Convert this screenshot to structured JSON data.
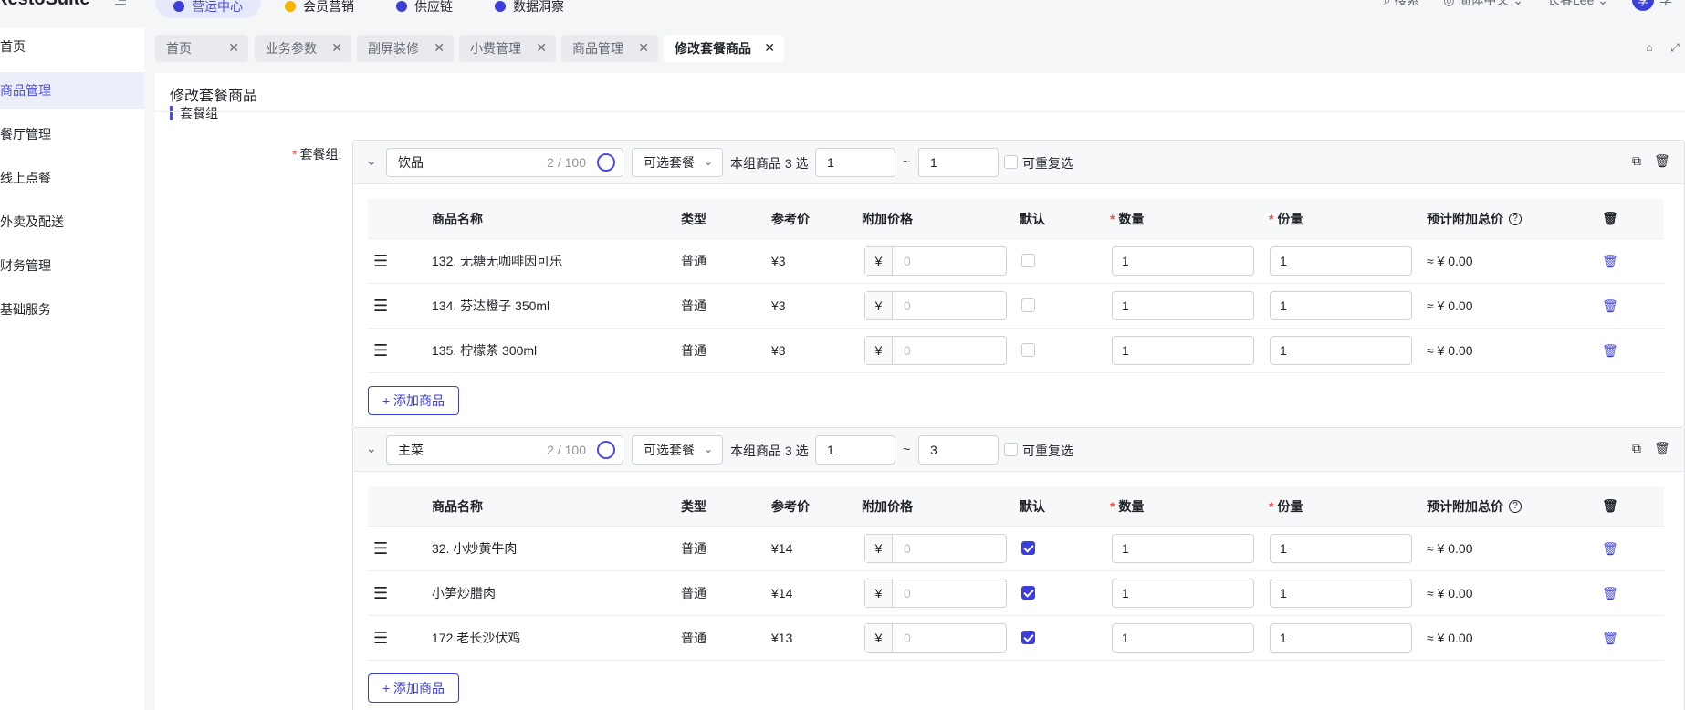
{
  "app": {
    "brand": "RestoSuite"
  },
  "topnav": {
    "items": [
      {
        "label": "营运中心",
        "color": "#3b3fd8"
      },
      {
        "label": "会员营销",
        "color": "#f5b400"
      },
      {
        "label": "供应链",
        "color": "#3b3fd8"
      },
      {
        "label": "数据洞察",
        "color": "#3b3fd8"
      }
    ],
    "search": "搜索",
    "language": "简体中文",
    "user": "长春Lee",
    "avatar_char": "李",
    "avatar_name": "李"
  },
  "sidebar": {
    "items": [
      {
        "label": "首页"
      },
      {
        "label": "商品管理"
      },
      {
        "label": "餐厅管理"
      },
      {
        "label": "线上点餐"
      },
      {
        "label": "外卖及配送"
      },
      {
        "label": "财务管理"
      },
      {
        "label": "基础服务"
      }
    ]
  },
  "tabs": [
    {
      "label": "首页"
    },
    {
      "label": "业务参数"
    },
    {
      "label": "副屏装修"
    },
    {
      "label": "小费管理"
    },
    {
      "label": "商品管理"
    },
    {
      "label": "修改套餐商品"
    }
  ],
  "page": {
    "title": "修改套餐商品",
    "section": "套餐组",
    "field_label": "套餐组:"
  },
  "table_header": {
    "name": "商品名称",
    "type": "类型",
    "ref_price": "参考价",
    "extra_price": "附加价格",
    "default": "默认",
    "qty": "数量",
    "portion": "份量",
    "total": "预计附加总价"
  },
  "groups": [
    {
      "name": "饮品",
      "count": "2 / 100",
      "mode": "可选套餐",
      "pick_text": "本组商品 3 选",
      "min": "1",
      "max": "1",
      "tilde": "~",
      "repeat_label": "可重复选",
      "add_label": "+ 添加商品",
      "rows": [
        {
          "name": "132. 无糖无咖啡因可乐",
          "type": "普通",
          "ref": "¥3",
          "currency": "¥",
          "placeholder": "0",
          "default": false,
          "qty": "1",
          "portion": "1",
          "total": "≈ ¥ 0.00"
        },
        {
          "name": "134. 芬达橙子 350ml",
          "type": "普通",
          "ref": "¥3",
          "currency": "¥",
          "placeholder": "0",
          "default": false,
          "qty": "1",
          "portion": "1",
          "total": "≈ ¥ 0.00"
        },
        {
          "name": "135. 柠檬茶 300ml",
          "type": "普通",
          "ref": "¥3",
          "currency": "¥",
          "placeholder": "0",
          "default": false,
          "qty": "1",
          "portion": "1",
          "total": "≈ ¥ 0.00"
        }
      ]
    },
    {
      "name": "主菜",
      "count": "2 / 100",
      "mode": "可选套餐",
      "pick_text": "本组商品 3 选",
      "min": "1",
      "max": "3",
      "tilde": "~",
      "repeat_label": "可重复选",
      "add_label": "+ 添加商品",
      "rows": [
        {
          "name": "32. 小炒黄牛肉",
          "type": "普通",
          "ref": "¥14",
          "currency": "¥",
          "placeholder": "0",
          "default": true,
          "qty": "1",
          "portion": "1",
          "total": "≈ ¥ 0.00"
        },
        {
          "name": "小笋炒腊肉",
          "type": "普通",
          "ref": "¥14",
          "currency": "¥",
          "placeholder": "0",
          "default": true,
          "qty": "1",
          "portion": "1",
          "total": "≈ ¥ 0.00"
        },
        {
          "name": "172.老长沙伏鸡",
          "type": "普通",
          "ref": "¥13",
          "currency": "¥",
          "placeholder": "0",
          "default": true,
          "qty": "1",
          "portion": "1",
          "total": "≈ ¥ 0.00"
        }
      ]
    }
  ],
  "colors": {
    "accent": "#3b3fd8",
    "required": "#f54a45"
  }
}
